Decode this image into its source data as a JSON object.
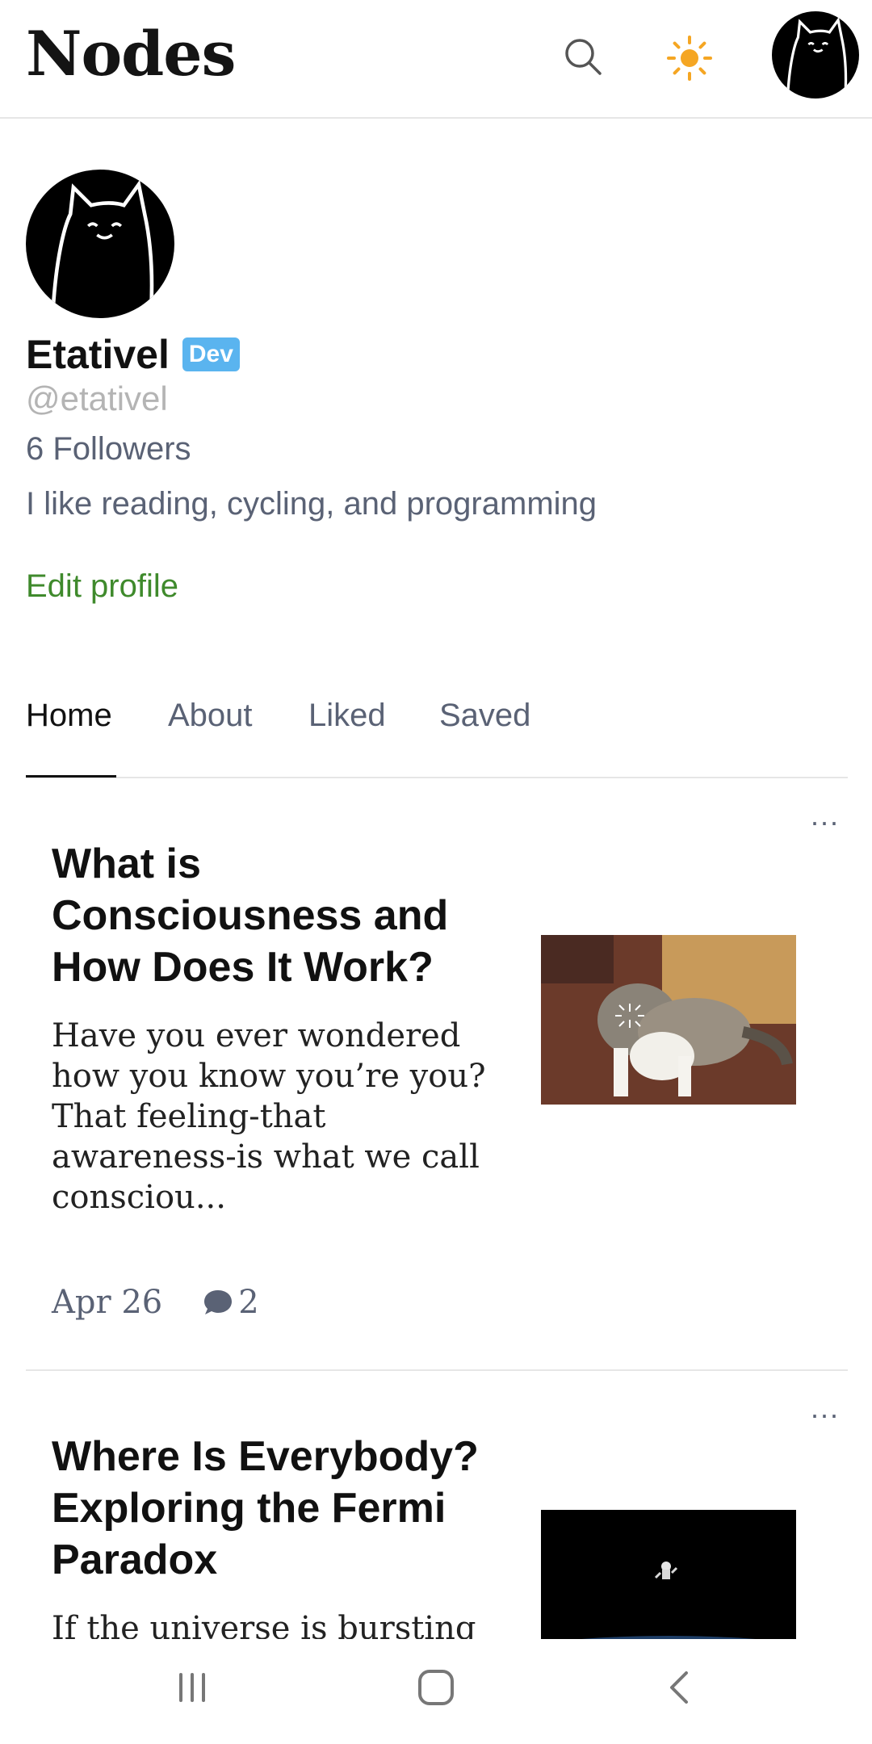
{
  "header": {
    "brand": "Nodes",
    "icons": {
      "search": "search-icon",
      "theme": "sun-icon",
      "avatar": "cat-avatar"
    },
    "accent_sun": "#f5a623"
  },
  "profile": {
    "name": "Etativel",
    "badge": "Dev",
    "handle": "@etativel",
    "followers": "6 Followers",
    "bio": "I like reading, cycling, and programming",
    "edit_label": "Edit profile",
    "colors": {
      "badge": "#5ab4ef",
      "edit": "#3f8a2c",
      "muted": "#5a6275"
    }
  },
  "tabs": [
    {
      "label": "Home",
      "active": true
    },
    {
      "label": "About",
      "active": false
    },
    {
      "label": "Liked",
      "active": false
    },
    {
      "label": "Saved",
      "active": false
    }
  ],
  "articles": [
    {
      "more": "...",
      "title": "What is Consciousness and How Does It Work?",
      "excerpt": "Have you ever wondered how you know you’re you? That feeling-that awareness-is what we call consciou...",
      "date": "Apr 26",
      "comments": "2",
      "thumb": "cat-loading-image"
    },
    {
      "more": "...",
      "title": "Where Is Everybody? Exploring the Fermi Paradox",
      "excerpt": "If the universe is bursting",
      "thumb": "astronaut-space-image"
    }
  ],
  "navbar": {
    "icons": [
      "recent-apps-icon",
      "home-icon",
      "back-icon"
    ]
  }
}
